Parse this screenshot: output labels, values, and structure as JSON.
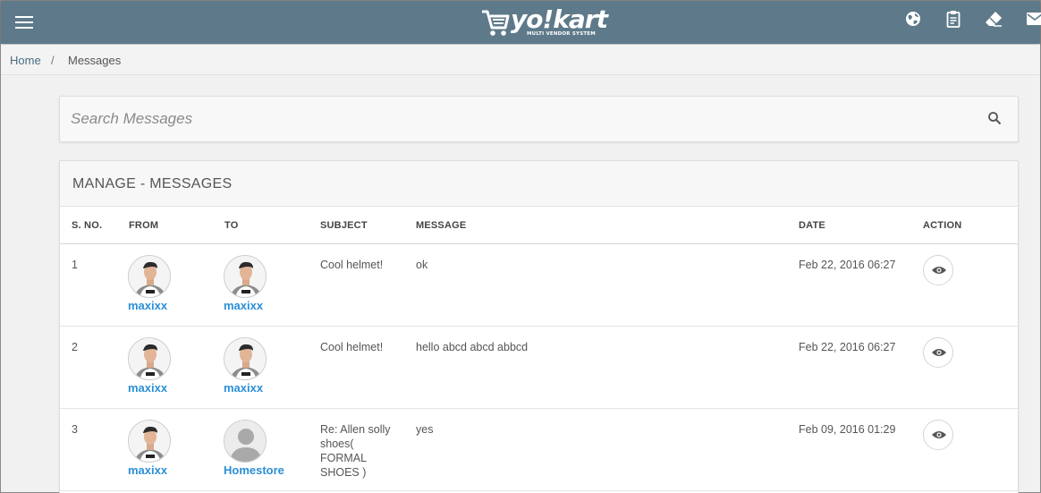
{
  "header": {
    "brand": "yo!kart",
    "tagline": "MULTI VENDOR SYSTEM",
    "icons": [
      "menu-icon",
      "globe-icon",
      "clipboard-icon",
      "eraser-icon",
      "mail-icon"
    ],
    "bar_color": "#5e7a8a"
  },
  "breadcrumb": {
    "home": "Home",
    "separator": "/",
    "current": "Messages"
  },
  "search": {
    "placeholder": "Search Messages",
    "value": ""
  },
  "table": {
    "title": "MANAGE - MESSAGES",
    "columns": {
      "sno": "S. NO.",
      "from": "FROM",
      "to": "TO",
      "subject": "SUBJECT",
      "message": "MESSAGE",
      "date": "DATE",
      "action": "ACTION"
    },
    "rows": [
      {
        "sno": "1",
        "from": "maxixx",
        "to": "maxixx",
        "subject": "Cool helmet!",
        "message": "ok",
        "date": "Feb 22, 2016 06:27"
      },
      {
        "sno": "2",
        "from": "maxixx",
        "to": "maxixx",
        "subject": "Cool helmet!",
        "message": "hello abcd abcd abbcd",
        "date": "Feb 22, 2016 06:27"
      },
      {
        "sno": "3",
        "from": "maxixx",
        "to": "Homestore",
        "subject": "Re: Allen solly shoes( FORMAL SHOES )",
        "message": "yes",
        "date": "Feb 09, 2016 01:29"
      }
    ],
    "link_color": "#2a8fd6"
  }
}
